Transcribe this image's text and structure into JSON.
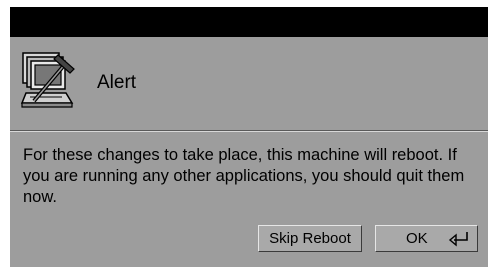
{
  "dialog": {
    "title": "Alert",
    "icon": "computer-with-hammer-icon",
    "message": "For these changes to take place, this machine will reboot.  If you are running any other applications, you should quit them now.",
    "buttons": {
      "skip_label": "Skip Reboot",
      "ok_label": "OK",
      "ok_icon": "return-key-icon"
    }
  },
  "colors": {
    "titlebar": "#000000",
    "dialog_background": "#9d9d9d"
  }
}
